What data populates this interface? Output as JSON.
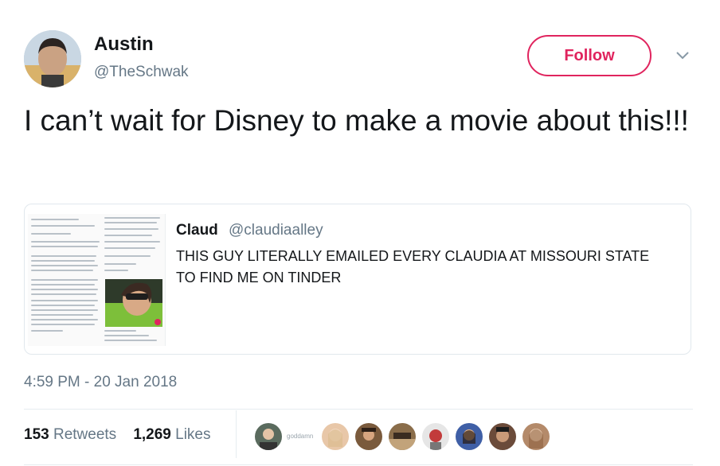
{
  "author": {
    "name": "Austin",
    "handle": "@TheSchwak"
  },
  "follow_label": "Follow",
  "tweet_text": "I can’t wait for Disney to make a movie about this!!!",
  "quoted": {
    "name": "Claud",
    "handle": "@claudiaalley",
    "text": "THIS GUY LITERALLY EMAILED EVERY CLAUDIA AT MISSOURI STATE TO FIND ME ON TINDER"
  },
  "timestamp": "4:59 PM - 20 Jan 2018",
  "stats": {
    "retweets_count": "153",
    "retweets_label": "Retweets",
    "likes_count": "1,269",
    "likes_label": "Likes"
  },
  "likers": {
    "caption": "goddamn",
    "colors": [
      "#5a6b5e",
      "#e8c7a8",
      "#7a5a3c",
      "#8a6d4a",
      "#c23b3b",
      "#3f5fa6",
      "#6b4b3a",
      "#b48a6a"
    ]
  },
  "colors": {
    "accent": "#e0245e",
    "secondary_text": "#657786",
    "primary_text": "#14171a",
    "border": "#e1e8ed"
  }
}
